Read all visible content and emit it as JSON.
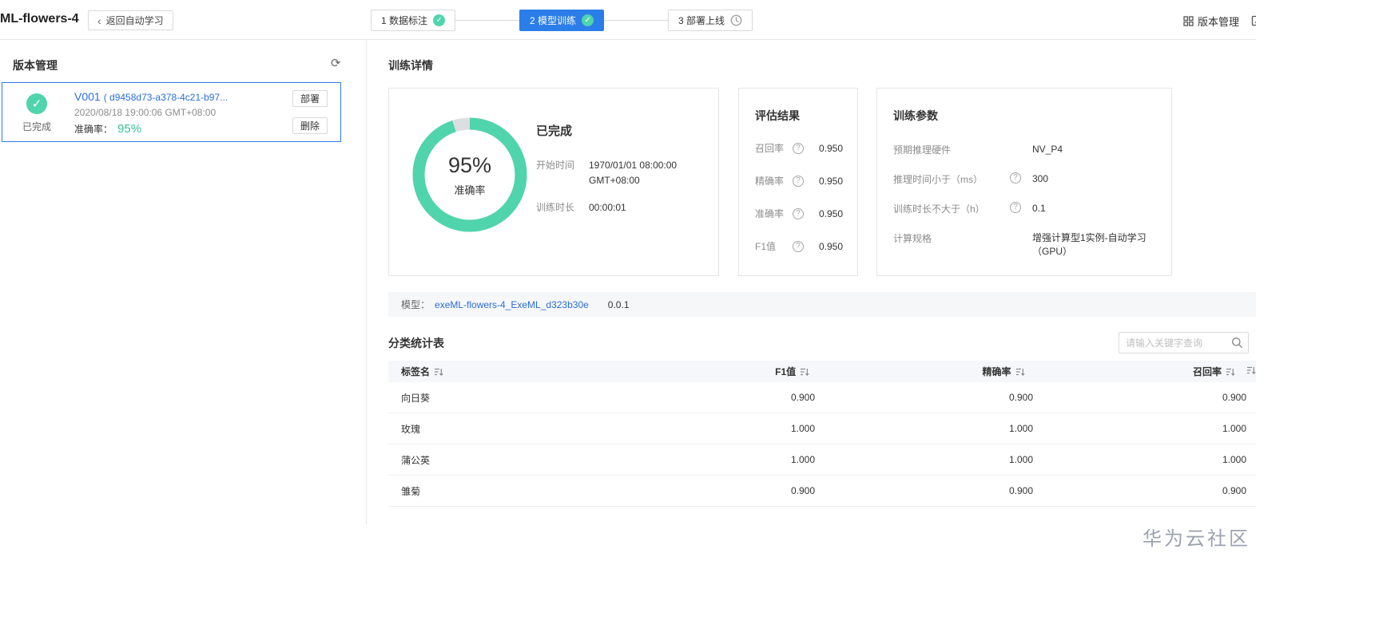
{
  "icons": {
    "check": "✓",
    "refresh": "⟳",
    "chevron_left": "‹",
    "help": "?"
  },
  "colors": {
    "accent_blue": "#2b7de9",
    "accent_green": "#50d4ab",
    "link_blue": "#2b6ed9"
  },
  "header": {
    "project_title": "ML-flowers-4",
    "back_label": "返回自动学习",
    "steps": [
      {
        "label": "1 数据标注",
        "status": "done"
      },
      {
        "label": "2 模型训练",
        "status": "active"
      },
      {
        "label": "3 部署上线",
        "status": "pending"
      }
    ],
    "version_manage_label": "版本管理"
  },
  "sidebar": {
    "title": "版本管理",
    "version": {
      "status": "已完成",
      "name": "V001",
      "id": "( d9458d73-a378-4c21-b97...",
      "time": "2020/08/18 19:00:06 GMT+08:00",
      "accuracy_label": "准确率：",
      "accuracy_value": "95%",
      "deploy_button": "部署",
      "delete_button": "删除"
    }
  },
  "main": {
    "title": "训练详情",
    "summary": {
      "status": "已完成",
      "start_label": "开始时间",
      "start_value": "1970/01/01 08:00:00 GMT+08:00",
      "duration_label": "训练时长",
      "duration_value": "00:00:01",
      "donut": {
        "percent": 95,
        "value_text": "95%",
        "label": "准确率"
      }
    },
    "evaluation": {
      "title": "评估结果",
      "metrics": [
        {
          "label": "召回率",
          "value": "0.950"
        },
        {
          "label": "精确率",
          "value": "0.950"
        },
        {
          "label": "准确率",
          "value": "0.950"
        },
        {
          "label": "F1值",
          "value": "0.950"
        }
      ]
    },
    "params": {
      "title": "训练参数",
      "items": [
        {
          "label": "预期推理硬件",
          "value": "NV_P4",
          "help": false
        },
        {
          "label": "推理时间小于（ms）",
          "value": "300",
          "help": true
        },
        {
          "label": "训练时长不大于（h）",
          "value": "0.1",
          "help": true
        },
        {
          "label": "计算规格",
          "value": "增强计算型1实例-自动学习（GPU）",
          "help": false
        }
      ]
    },
    "model": {
      "label": "模型：",
      "link": "exeML-flowers-4_ExeML_d323b30e",
      "version": "0.0.1"
    },
    "table_section": {
      "title": "分类统计表",
      "search_placeholder": "请输入关键字查询"
    },
    "table": {
      "columns": [
        "标签名",
        "F1值",
        "精确率",
        "召回率"
      ],
      "rows": [
        [
          "向日葵",
          "0.900",
          "0.900",
          "0.900"
        ],
        [
          "玫瑰",
          "1.000",
          "1.000",
          "1.000"
        ],
        [
          "蒲公英",
          "1.000",
          "1.000",
          "1.000"
        ],
        [
          "雏菊",
          "0.900",
          "0.900",
          "0.900"
        ]
      ]
    }
  },
  "watermark": "华为云社区"
}
